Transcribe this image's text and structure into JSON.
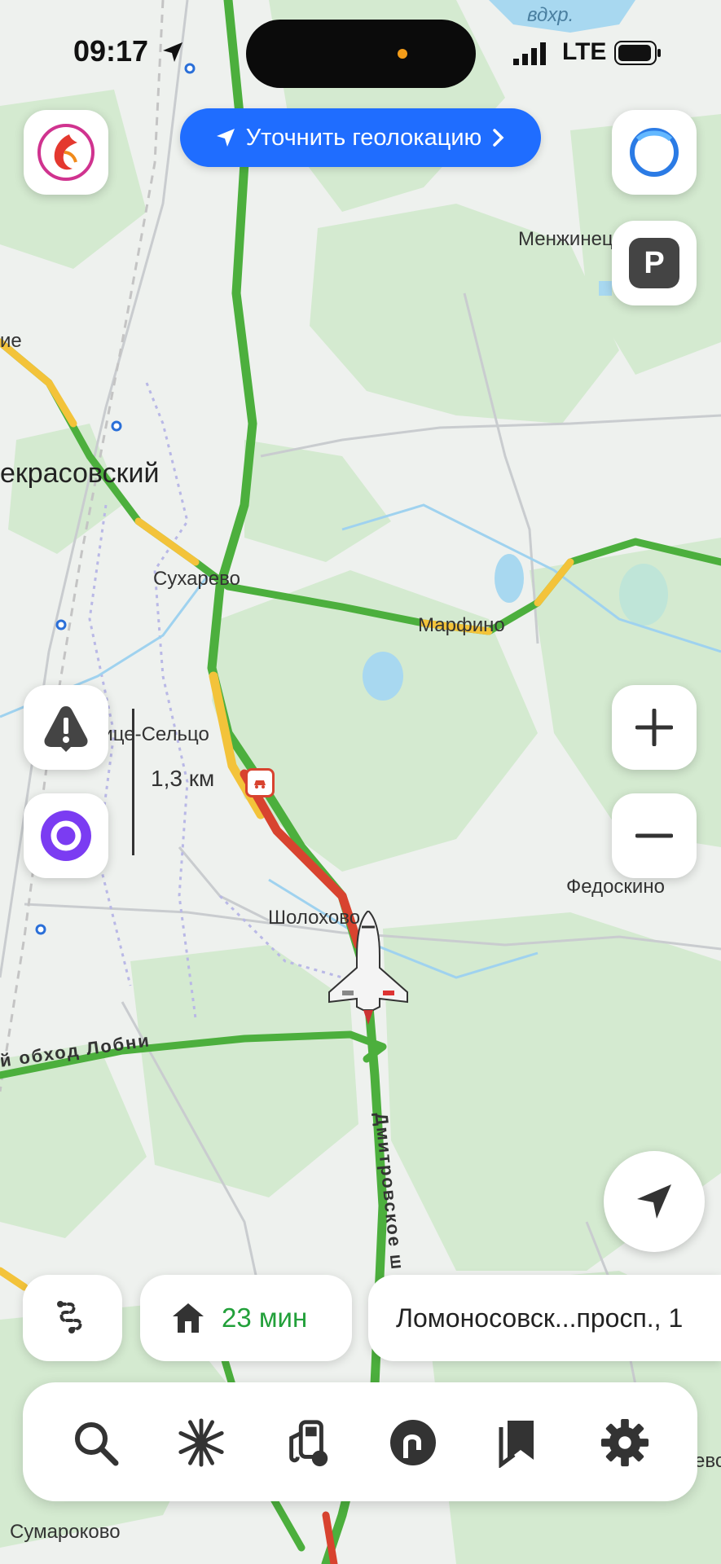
{
  "status_bar": {
    "time": "09:17",
    "network": "LTE"
  },
  "geo_button": {
    "label": "Уточнить геолокацию"
  },
  "parking_button": {
    "label": "P"
  },
  "map_labels": {
    "vdhr": "вдхр.",
    "menzhinets": "Менжинец",
    "ie": "ие",
    "nekrasovsky": "екрасовский",
    "sukharevo": "Сухарево",
    "marfino": "Марфино",
    "troitse": "оице-Сельцо",
    "fedoskino": "Федоскино",
    "sholokhovo": "Шолохово",
    "obkhod": "й обход Лобни",
    "dmitrovskoe": "Дмитровское ш",
    "sumarokovo": "Сумароково",
    "evo": "ево"
  },
  "scale": {
    "text": "1,3 км"
  },
  "route_bar": {
    "eta": "23 мин",
    "destination": "Ломоносовск...просп., 1"
  },
  "toolbar": {
    "items": [
      "search-icon",
      "burst-icon",
      "fuel-icon",
      "route-icon",
      "bookmarks-icon",
      "gear-icon"
    ]
  },
  "colors": {
    "accent": "#1f6dff",
    "road_green": "#4caf3d",
    "road_yellow": "#f3c33a",
    "road_red": "#d8432f",
    "forest": "#d6ecd2",
    "water": "#a8d8f0",
    "alice_purple": "#7b3cf2"
  }
}
